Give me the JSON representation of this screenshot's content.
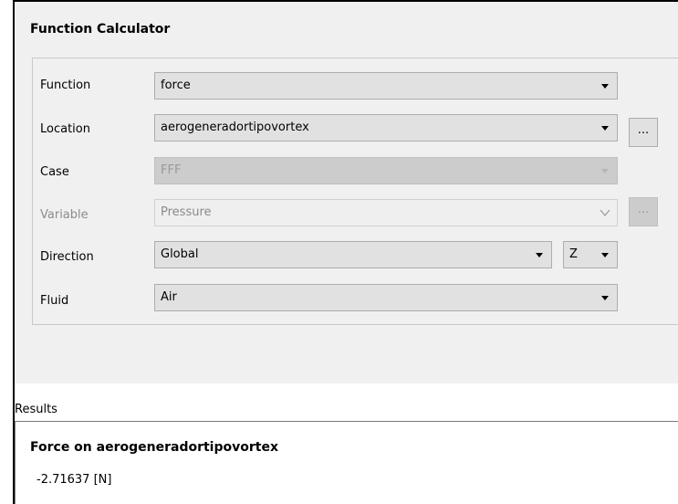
{
  "panel": {
    "title": "Function Calculator"
  },
  "fields": {
    "function": {
      "label": "Function",
      "value": "force"
    },
    "location": {
      "label": "Location",
      "value": "aerogeneradortipovortex",
      "button": "..."
    },
    "case": {
      "label": "Case",
      "value": "FFF"
    },
    "variable": {
      "label": "Variable",
      "value": "Pressure",
      "button": "..."
    },
    "direction": {
      "label": "Direction",
      "value": "Global",
      "axis": "Z"
    },
    "fluid": {
      "label": "Fluid",
      "value": "Air"
    }
  },
  "results": {
    "label": "Results",
    "title": "Force on aerogeneradortipovortex",
    "value": "-2.71637 [N]"
  }
}
